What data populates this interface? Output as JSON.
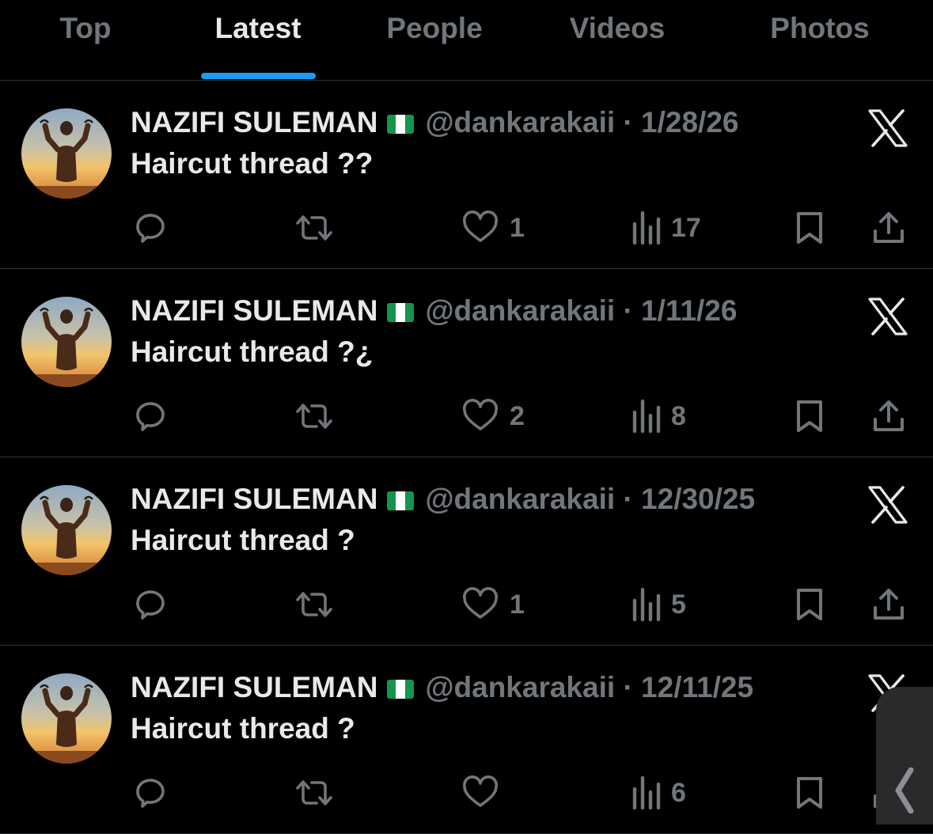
{
  "tabs": [
    "Top",
    "Latest",
    "People",
    "Videos",
    "Photos"
  ],
  "active_tab": "Latest",
  "colors": {
    "accent": "#1d9bf0",
    "muted": "#71767b",
    "text": "#e7e9ea",
    "background": "#000000"
  },
  "tweets": [
    {
      "name": "NAZIFI SULEMAN",
      "handle": "@dankarakaii",
      "separator": "·",
      "date": "1/28/26",
      "text": "Haircut thread ??",
      "likes": "1",
      "views": "17"
    },
    {
      "name": "NAZIFI SULEMAN",
      "handle": "@dankarakaii",
      "separator": "·",
      "date": "1/11/26",
      "text": "Haircut thread ?¿",
      "likes": "2",
      "views": "8"
    },
    {
      "name": "NAZIFI SULEMAN",
      "handle": "@dankarakaii",
      "separator": "·",
      "date": "12/30/25",
      "text": "Haircut thread ?",
      "likes": "1",
      "views": "5"
    },
    {
      "name": "NAZIFI SULEMAN",
      "handle": "@dankarakaii",
      "separator": "·",
      "date": "12/11/25",
      "text": "Haircut thread ?",
      "likes": "",
      "views": "6"
    }
  ],
  "icons": [
    "reply-icon",
    "retweet-icon",
    "like-icon",
    "views-icon",
    "bookmark-icon",
    "share-icon",
    "x-logo-icon",
    "nigeria-flag-icon",
    "chevron-left-icon"
  ]
}
